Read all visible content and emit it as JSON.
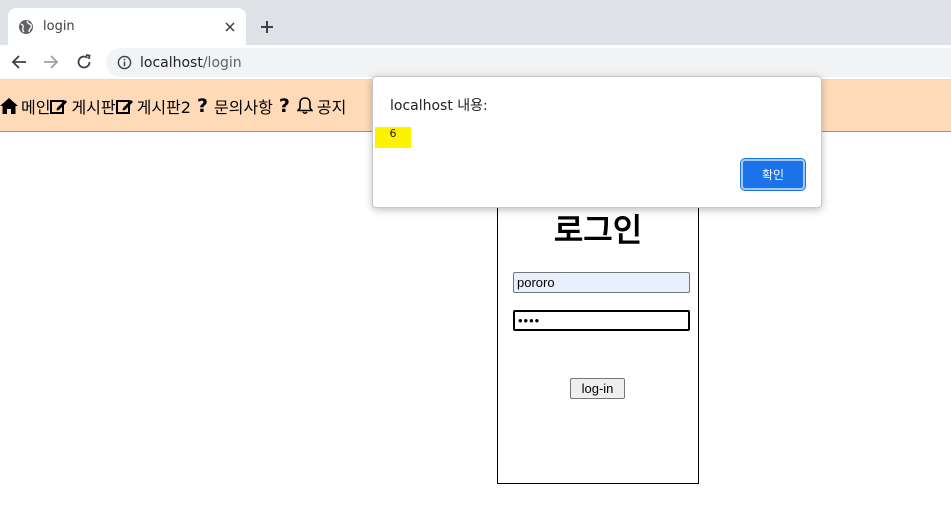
{
  "browser": {
    "tab_title": "login",
    "url_host": "localhost",
    "url_path": "/login"
  },
  "site_nav": {
    "items": [
      {
        "label": "메인",
        "icon": "home-icon"
      },
      {
        "label": "게시판",
        "icon": "edit-icon"
      },
      {
        "label": "게시판2",
        "icon": "edit-icon"
      },
      {
        "label": "문의사항",
        "icon": "question-icon"
      },
      {
        "label": "공지",
        "icon": "bell-icon"
      }
    ]
  },
  "login": {
    "title": "로그인",
    "username_value": "pororo",
    "password_value": "••••",
    "button_label": "log-in"
  },
  "dialog": {
    "title": "localhost 내용:",
    "message": "6",
    "ok_label": "확인"
  },
  "colors": {
    "nav_background": "#ffdab9",
    "dialog_ok": "#1a73e8",
    "message_highlight": "#fff200"
  }
}
